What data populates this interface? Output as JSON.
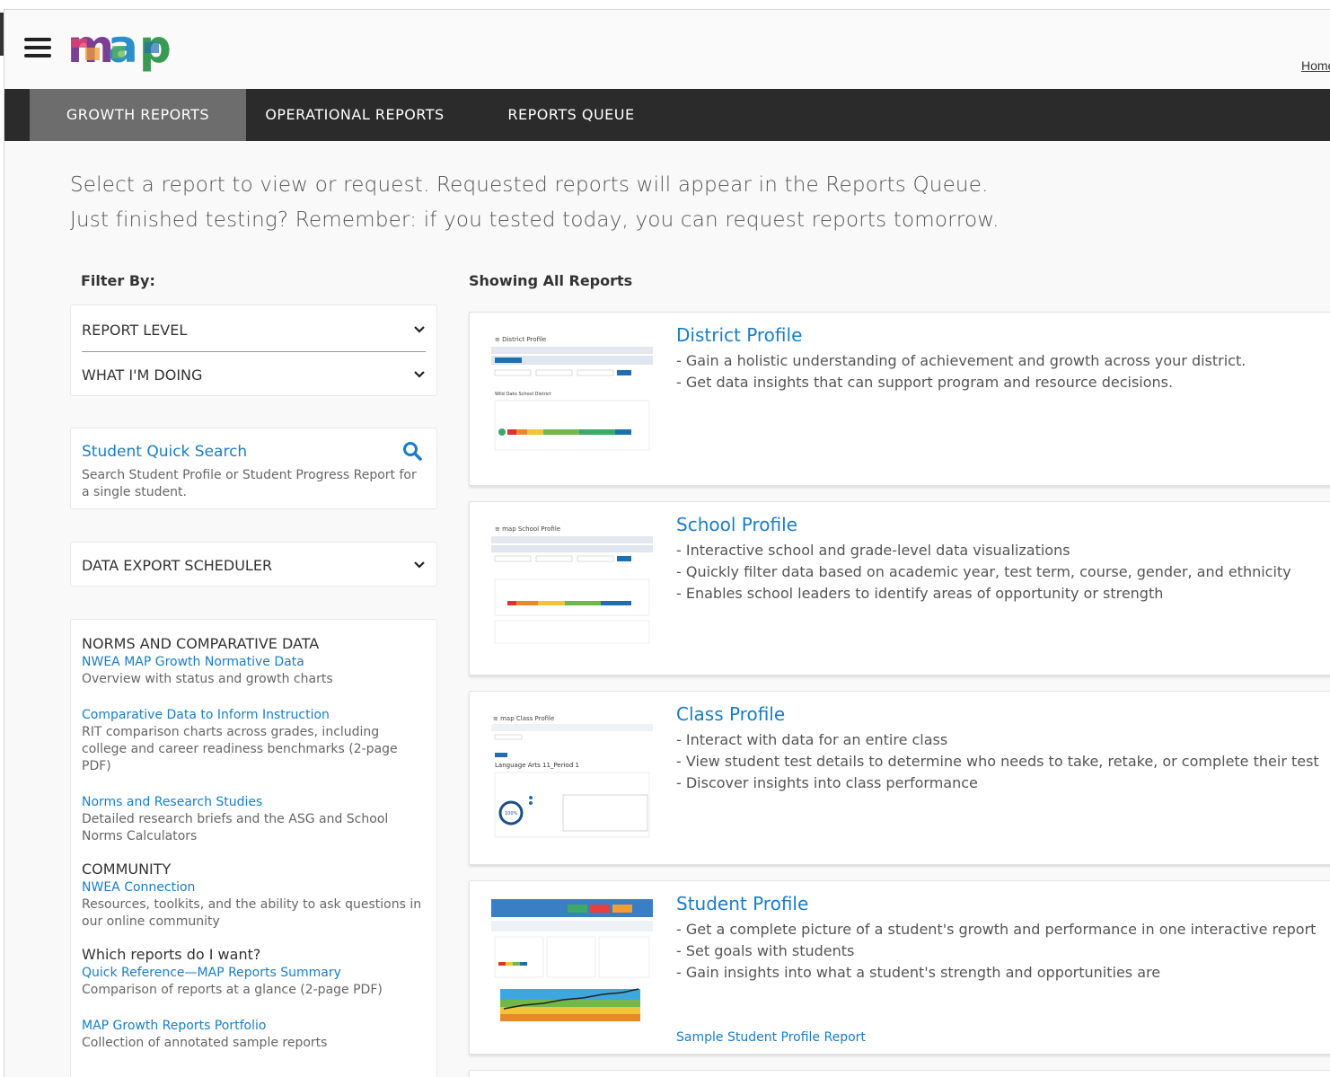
{
  "header": {
    "logo_alt": "map",
    "home_link": "Home"
  },
  "nav": {
    "tabs": [
      {
        "label": "GROWTH REPORTS",
        "active": true
      },
      {
        "label": "OPERATIONAL REPORTS",
        "active": false
      },
      {
        "label": "REPORTS QUEUE",
        "active": false
      }
    ]
  },
  "intro": {
    "line1": "Select a report to view or request. Requested reports will appear in the Reports Queue.",
    "line2": "Just finished testing? Remember: if you tested today, you can request reports tomorrow."
  },
  "filters": {
    "title": "Filter By:",
    "report_level": "REPORT LEVEL",
    "what_doing": "WHAT I'M DOING"
  },
  "quick_search": {
    "title": "Student Quick Search",
    "desc": "Search Student Profile or Student Progress Report for a single student."
  },
  "export_scheduler": {
    "label": "DATA EXPORT SCHEDULER"
  },
  "resources": {
    "norms_heading": "NORMS AND COMPARATIVE DATA",
    "norms_link": "NWEA MAP Growth Normative Data",
    "norms_desc": "Overview with status and growth charts",
    "comp_link": "Comparative Data to Inform Instruction",
    "comp_desc": "RIT comparison charts across grades, including college and career readiness benchmarks (2-page PDF)",
    "research_link": "Norms and Research Studies",
    "research_desc": "Detailed research briefs and the ASG and School Norms Calculators",
    "community_heading": "COMMUNITY",
    "connection_link": "NWEA Connection",
    "connection_desc": "Resources, toolkits, and the ability to ask questions in our online community",
    "which_heading": "Which reports do I want?",
    "quickref_link": "Quick Reference—MAP Reports Summary",
    "quickref_desc": "Comparison of reports at a glance (2-page PDF)",
    "portfolio_link": "MAP Growth Reports Portfolio",
    "portfolio_desc": "Collection of annotated sample reports"
  },
  "reports": {
    "showing": "Showing All Reports",
    "cards": [
      {
        "title": "District Profile",
        "bullets": [
          "- Gain a holistic understanding of achievement and growth across your district.",
          "- Get data insights that can support program and resource decisions."
        ]
      },
      {
        "title": "School Profile",
        "bullets": [
          "- Interactive school and grade-level data visualizations",
          "- Quickly filter data based on academic year, test term, course, gender, and ethnicity",
          "- Enables school leaders to identify areas of opportunity or strength"
        ]
      },
      {
        "title": "Class Profile",
        "bullets": [
          "- Interact with data for an entire class",
          "- View student test details to determine who needs to take, retake, or complete their test",
          "- Discover insights into class performance"
        ]
      },
      {
        "title": "Student Profile",
        "bullets": [
          "- Get a complete picture of a student's growth and performance in one interactive report",
          "- Set goals with students",
          "- Gain insights into what a student's strength and opportunities are"
        ],
        "sample_link": "Sample Student Profile Report"
      }
    ]
  },
  "colors": {
    "accent": "#1a7dc4",
    "nav_bg": "#2b2b2b",
    "nav_active": "#6d6d6d"
  }
}
